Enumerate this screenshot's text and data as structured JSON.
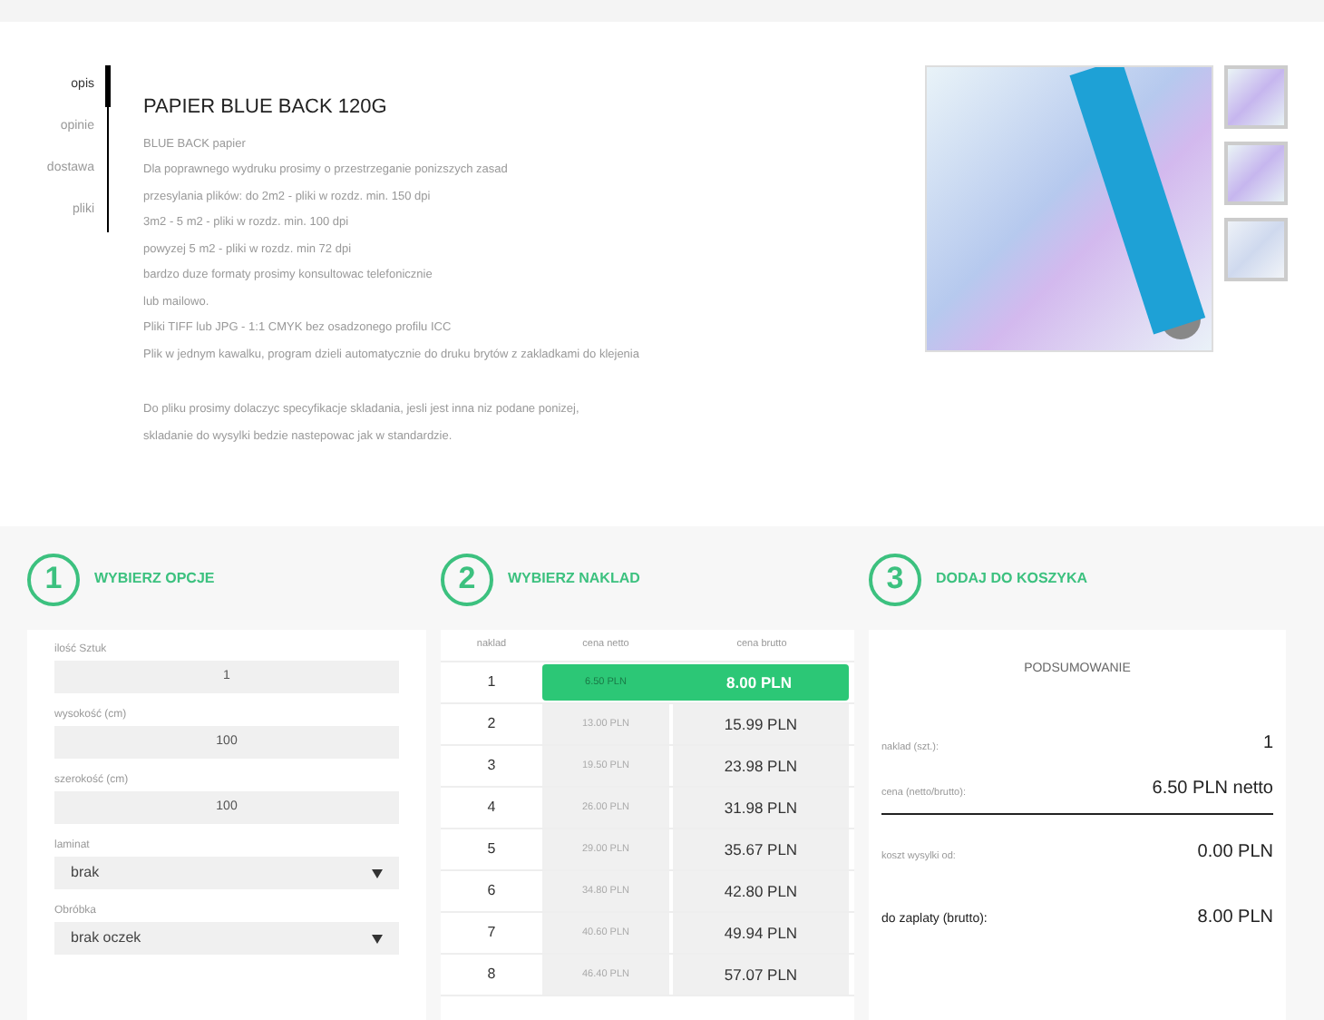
{
  "tabs": [
    {
      "label": "opis",
      "selected": true
    },
    {
      "label": "opinie",
      "selected": false
    },
    {
      "label": "dostawa",
      "selected": false
    },
    {
      "label": "pliki",
      "selected": false
    }
  ],
  "product": {
    "title": "PAPIER BLUE BACK 120G",
    "paragraphs": [
      [
        "BLUE BACK papier",
        "Dla poprawnego wydruku prosimy o przestrzeganie ponizszych zasad",
        "przesylania plików: do 2m2 - pliki w rozdz. min. 150 dpi",
        "3m2 - 5 m2 - pliki w rozdz. min. 100 dpi",
        "powyzej 5 m2 - pliki w rozdz. min 72 dpi",
        "bardzo duze formaty prosimy konsultowac telefonicznie",
        "lub mailowo.",
        "Pliki TIFF lub JPG - 1:1 CMYK bez osadzonego profilu ICC",
        "Plik w jednym kawalku, program dzieli automatycznie do druku brytów z zakladkami do klejenia"
      ],
      [
        "Do pliku prosimy dolaczyc specyfikacje skladania, jesli jest inna niz podane ponizej,",
        "skladanie do wysylki bedzie nastepowac jak w standardzie."
      ]
    ]
  },
  "steps": [
    {
      "number": "1",
      "title": "WYBIERZ OPCJE"
    },
    {
      "number": "2",
      "title": "WYBIERZ NAKLAD"
    },
    {
      "number": "3",
      "title": "DODAJ DO KOSZYKA"
    }
  ],
  "options": [
    {
      "kind": "number",
      "label": "ilość Sztuk",
      "value": "1"
    },
    {
      "kind": "number",
      "label": "wysokość (cm)",
      "value": "100"
    },
    {
      "kind": "number",
      "label": "szerokość (cm)",
      "value": "100"
    },
    {
      "kind": "select",
      "label": "laminat",
      "value": "brak"
    },
    {
      "kind": "select",
      "label": "Obróbka",
      "value": "brak oczek"
    }
  ],
  "price_table": {
    "columns": [
      "naklad",
      "cena netto",
      "cena brutto"
    ],
    "rows": [
      {
        "naklad": "1",
        "netto": "6.50 PLN",
        "brutto": "8.00 PLN",
        "selected": true
      },
      {
        "naklad": "2",
        "netto": "13.00 PLN",
        "brutto": "15.99 PLN",
        "selected": false
      },
      {
        "naklad": "3",
        "netto": "19.50 PLN",
        "brutto": "23.98 PLN",
        "selected": false
      },
      {
        "naklad": "4",
        "netto": "26.00 PLN",
        "brutto": "31.98 PLN",
        "selected": false
      },
      {
        "naklad": "5",
        "netto": "29.00 PLN",
        "brutto": "35.67 PLN",
        "selected": false
      },
      {
        "naklad": "6",
        "netto": "34.80 PLN",
        "brutto": "42.80 PLN",
        "selected": false
      },
      {
        "naklad": "7",
        "netto": "40.60 PLN",
        "brutto": "49.94 PLN",
        "selected": false
      },
      {
        "naklad": "8",
        "netto": "46.40 PLN",
        "brutto": "57.07 PLN",
        "selected": false
      }
    ]
  },
  "summary": {
    "title": "PODSUMOWANIE",
    "rows": [
      {
        "kind": "small",
        "label": "naklad (szt.):",
        "value": "1"
      },
      {
        "kind": "divided",
        "label": "cena (netto/brutto):",
        "value": "6.50 PLN netto"
      },
      {
        "kind": "small",
        "label": "koszt wysylki od:",
        "value": "0.00 PLN"
      },
      {
        "kind": "total",
        "label": "do zaplaty (brutto):",
        "value": "8.00 PLN"
      }
    ]
  }
}
